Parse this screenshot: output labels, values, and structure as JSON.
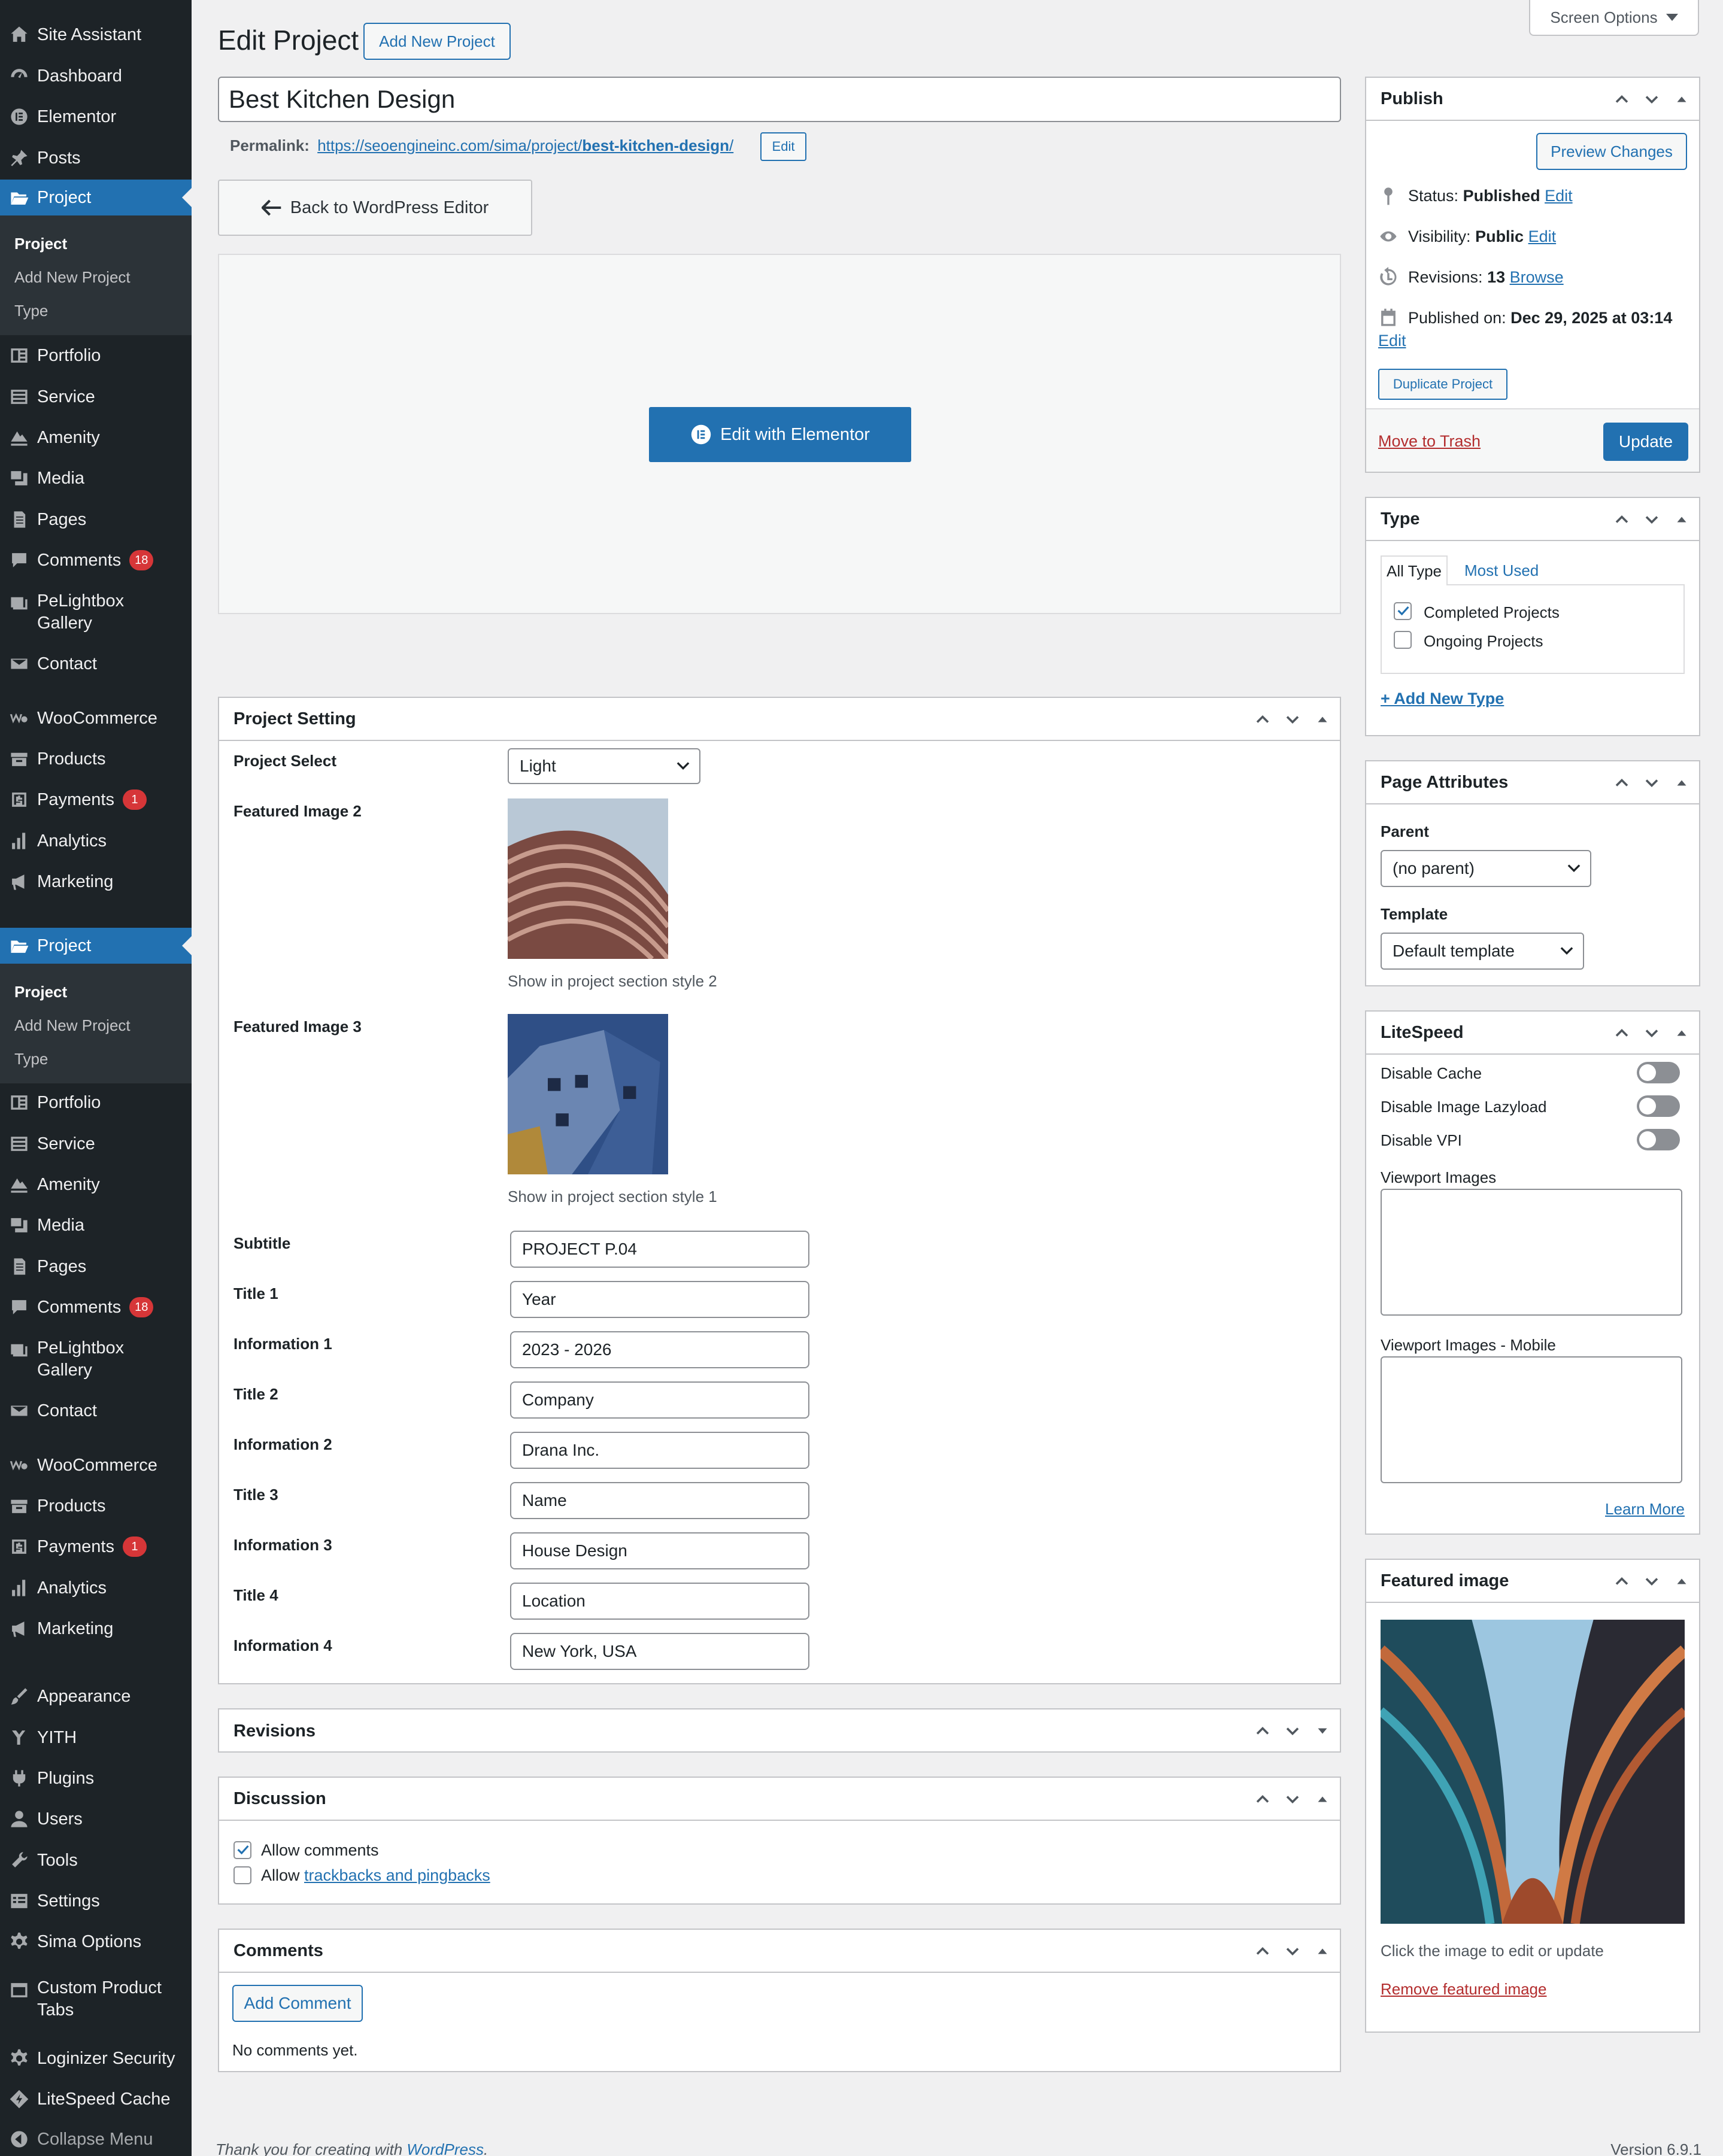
{
  "menu": {
    "site_assistant": "Site Assistant",
    "dashboard": "Dashboard",
    "elementor": "Elementor",
    "posts": "Posts",
    "project": "Project",
    "project_sub": [
      "Project",
      "Add New Project",
      "Type"
    ],
    "portfolio": "Portfolio",
    "service": "Service",
    "amenity": "Amenity",
    "media": "Media",
    "pages": "Pages",
    "comments": "Comments",
    "comments_count": "18",
    "pelightbox_1": "PeLightbox",
    "pelightbox_2": "Gallery",
    "contact": "Contact",
    "woocommerce": "WooCommerce",
    "products": "Products",
    "payments": "Payments",
    "payments_count": "1",
    "analytics": "Analytics",
    "marketing": "Marketing",
    "appearance": "Appearance",
    "yith": "YITH",
    "plugins": "Plugins",
    "users": "Users",
    "tools": "Tools",
    "settings": "Settings",
    "sima_options": "Sima Options",
    "custom_tabs_1": "Custom Product",
    "custom_tabs_2": "Tabs",
    "loginizer": "Loginizer Security",
    "litespeed": "LiteSpeed Cache",
    "collapse": "Collapse Menu"
  },
  "header": {
    "title": "Edit Project",
    "add_new": "Add New Project",
    "screen_options": "Screen Options"
  },
  "post": {
    "title": "Best Kitchen Design",
    "permalink_label": "Permalink:",
    "permalink_base": "https://seoengineinc.com/sima/project/",
    "permalink_slug": "best-kitchen-design",
    "permalink_slash": "/",
    "permalink_edit": "Edit"
  },
  "elementor": {
    "back": "Back to WordPress Editor",
    "edit": "Edit with Elementor"
  },
  "project_setting": {
    "title": "Project Setting",
    "select_label": "Project Select",
    "select_value": "Light",
    "fi2_label": "Featured Image 2",
    "fi2_desc": "Show in project section style 2",
    "fi3_label": "Featured Image 3",
    "fi3_desc": "Show in project section style 1",
    "fields": [
      {
        "label": "Subtitle",
        "value": "PROJECT P.04"
      },
      {
        "label": "Title 1",
        "value": "Year"
      },
      {
        "label": "Information 1",
        "value": "2023 - 2026"
      },
      {
        "label": "Title 2",
        "value": "Company"
      },
      {
        "label": "Information 2",
        "value": "Drana Inc."
      },
      {
        "label": "Title 3",
        "value": "Name"
      },
      {
        "label": "Information 3",
        "value": "House Design"
      },
      {
        "label": "Title 4",
        "value": "Location"
      },
      {
        "label": "Information 4",
        "value": "New York, USA"
      }
    ]
  },
  "revisions": {
    "title": "Revisions"
  },
  "discussion": {
    "title": "Discussion",
    "allow_comments": "Allow comments",
    "allow": "Allow",
    "trackbacks": "trackbacks and pingbacks"
  },
  "comments": {
    "title": "Comments",
    "add": "Add Comment",
    "none": "No comments yet."
  },
  "publish": {
    "title": "Publish",
    "preview": "Preview Changes",
    "status_label": "Status:",
    "status": "Published",
    "visibility_label": "Visibility:",
    "visibility": "Public",
    "revisions_label": "Revisions:",
    "revisions": "13",
    "browse": "Browse",
    "published_label": "Published on:",
    "published": "Dec 29, 2025 at 03:14",
    "edit": "Edit",
    "duplicate": "Duplicate Project",
    "trash": "Move to Trash",
    "update": "Update"
  },
  "type": {
    "title": "Type",
    "tab_all": "All Type",
    "tab_most": "Most Used",
    "completed": "Completed Projects",
    "ongoing": "Ongoing Projects",
    "add": "+ Add New Type"
  },
  "page_attributes": {
    "title": "Page Attributes",
    "parent_label": "Parent",
    "parent": "(no parent)",
    "template_label": "Template",
    "template": "Default template"
  },
  "litespeed": {
    "title": "LiteSpeed",
    "disable_cache": "Disable Cache",
    "disable_lazy": "Disable Image Lazyload",
    "disable_vpi": "Disable VPI",
    "viewport": "Viewport Images",
    "viewport_mobile": "Viewport Images - Mobile",
    "learn_more": "Learn More"
  },
  "featured": {
    "title": "Featured image",
    "hint": "Click the image to edit or update",
    "remove": "Remove featured image"
  },
  "footer": {
    "thanks": "Thank you for creating with",
    "wp": "WordPress",
    "period": ".",
    "version": "Version 6.9.1"
  },
  "colors": {
    "accent": "#2271b1",
    "menu_bg": "#1d2327",
    "danger": "#d63638"
  }
}
